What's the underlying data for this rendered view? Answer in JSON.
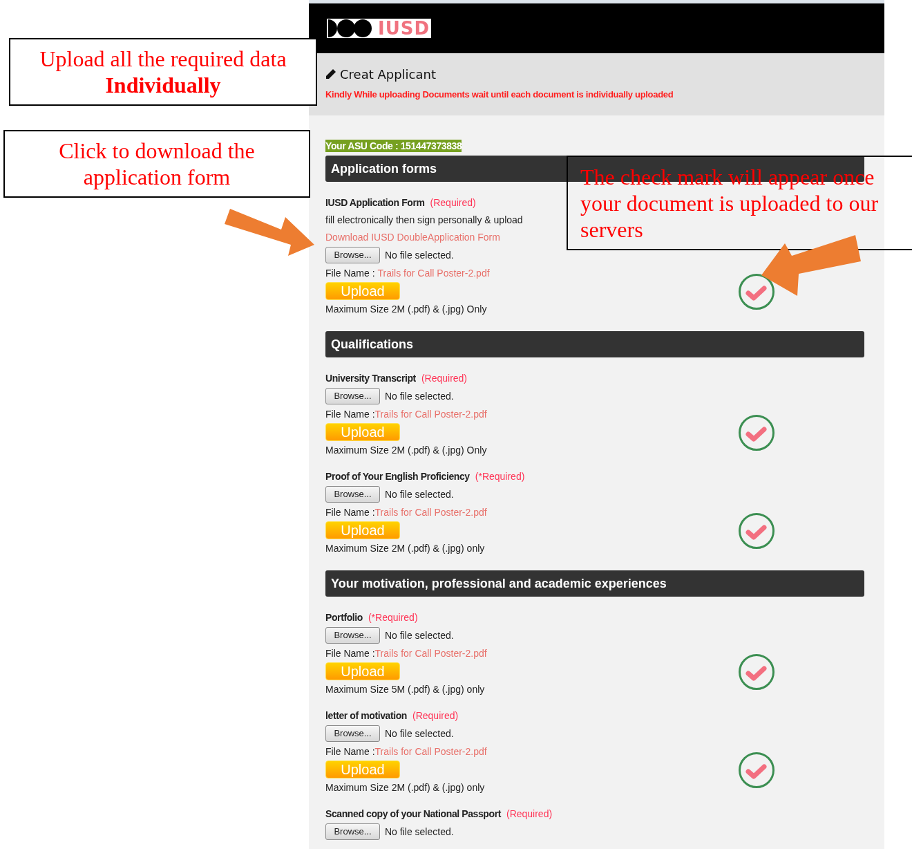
{
  "header": {
    "logo_text": "IUSD"
  },
  "page_title": "Creat Applicant",
  "notice": "Kindly While uploading Documents wait until each document is individually uploaded",
  "asu_code": "Your ASU Code : 151447373838",
  "sections": [
    {
      "title": "Application forms",
      "items": [
        {
          "title": "IUSD Application Form",
          "required": "(Required)",
          "description": "fill electronically then sign personally & upload",
          "download_link": "Download IUSD DoubleApplication Form",
          "browse_button": "Browse...",
          "file_status": "No file selected.",
          "file_name_label": "File Name : ",
          "file_name": "Trails for Call Poster-2.pdf",
          "upload_button": "Upload",
          "size_note": "Maximum Size 2M (.pdf) & (.jpg) Only",
          "checked": true
        }
      ]
    },
    {
      "title": "Qualifications",
      "items": [
        {
          "title": "University Transcript",
          "required": "(Required)",
          "browse_button": "Browse...",
          "file_status": "No file selected.",
          "file_name_label": "File Name :",
          "file_name": "Trails for Call Poster-2.pdf",
          "upload_button": "Upload",
          "size_note": "Maximum Size 2M (.pdf) & (.jpg) Only",
          "checked": true
        },
        {
          "title": "Proof of Your English Proficiency",
          "required": "(*Required)",
          "browse_button": "Browse...",
          "file_status": "No file selected.",
          "file_name_label": "File Name :",
          "file_name": "Trails for Call Poster-2.pdf",
          "upload_button": "Upload",
          "size_note": "Maximum Size 2M (.pdf) & (.jpg) only",
          "checked": true
        }
      ]
    },
    {
      "title": "Your motivation, professional and academic experiences",
      "items": [
        {
          "title": "Portfolio",
          "required": "(*Required)",
          "browse_button": "Browse...",
          "file_status": "No file selected.",
          "file_name_label": "File Name :",
          "file_name": "Trails for Call Poster-2.pdf",
          "upload_button": "Upload",
          "size_note": "Maximum Size 5M (.pdf) & (.jpg) only",
          "checked": true
        },
        {
          "title": "letter of motivation",
          "required": "(Required)",
          "browse_button": "Browse...",
          "file_status": "No file selected.",
          "file_name_label": "File Name :",
          "file_name": "Trails for Call Poster-2.pdf",
          "upload_button": "Upload",
          "size_note": "Maximum Size 2M (.pdf) & (.jpg) only",
          "checked": true
        },
        {
          "title": "Scanned copy of your National Passport",
          "required": "(Required)",
          "browse_button": "Browse...",
          "file_status": "No file selected."
        }
      ]
    }
  ],
  "annotations": [
    {
      "kind": "callout",
      "text": "Upload all the required data **Individually**"
    },
    {
      "kind": "callout",
      "text": "Click to download the application form"
    },
    {
      "kind": "arrow"
    },
    {
      "kind": "callout",
      "text": "The check mark will appear once your document is uploaded to our servers"
    },
    {
      "kind": "arrow"
    }
  ]
}
